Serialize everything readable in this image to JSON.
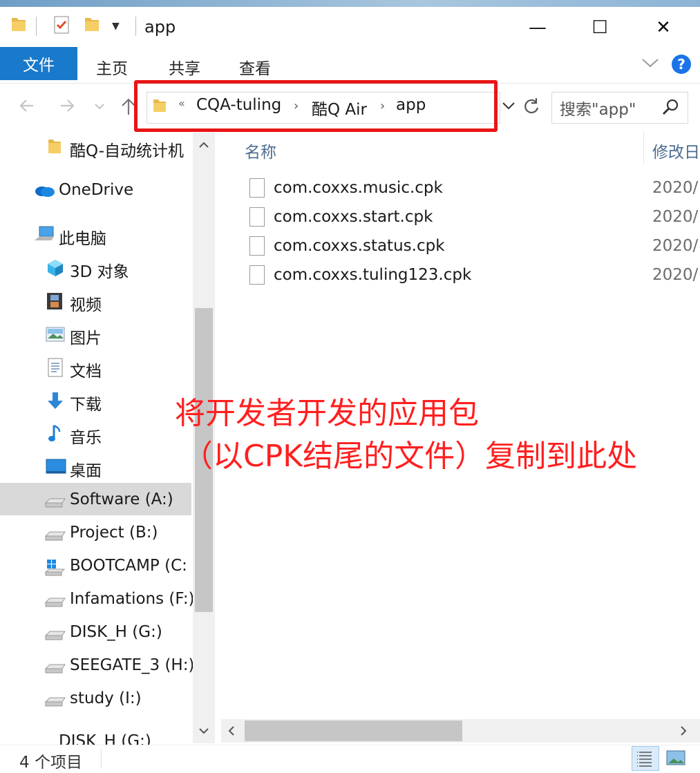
{
  "window": {
    "title": "app",
    "minimize": "—",
    "maximize": "☐",
    "close": "✕"
  },
  "ribbon": {
    "tabs": [
      "文件",
      "主页",
      "共享",
      "查看"
    ],
    "help": "?"
  },
  "address": {
    "overflow": "«",
    "crumbs": [
      "CQA-tuling",
      "酷Q Air",
      "app"
    ],
    "separator": "›"
  },
  "search": {
    "placeholder": "搜索\"app\""
  },
  "nav_pane": {
    "items": [
      {
        "label": "酷Q-自动统计机",
        "icon": "folder-icon"
      },
      {
        "label": "OneDrive",
        "icon": "cloud-icon"
      },
      {
        "label": "此电脑",
        "icon": "computer-icon"
      },
      {
        "label": "3D 对象",
        "icon": "cube-icon"
      },
      {
        "label": "视频",
        "icon": "film-icon"
      },
      {
        "label": "图片",
        "icon": "picture-icon"
      },
      {
        "label": "文档",
        "icon": "document-icon"
      },
      {
        "label": "下载",
        "icon": "download-arrow-icon"
      },
      {
        "label": "音乐",
        "icon": "music-note-icon"
      },
      {
        "label": "桌面",
        "icon": "desktop-icon"
      },
      {
        "label": "Software (A:)",
        "icon": "drive-icon"
      },
      {
        "label": "Project (B:)",
        "icon": "drive-icon"
      },
      {
        "label": "BOOTCAMP (C:",
        "icon": "windows-drive-icon"
      },
      {
        "label": "Infamations (F:)",
        "icon": "drive-icon"
      },
      {
        "label": "DISK_H (G:)",
        "icon": "drive-icon"
      },
      {
        "label": "SEEGATE_3 (H:)",
        "icon": "drive-icon"
      },
      {
        "label": "study (I:)",
        "icon": "drive-icon"
      },
      {
        "label": "DISK_H (G:)",
        "icon": "drive-icon"
      }
    ],
    "selected": "Software (A:)"
  },
  "columns": {
    "name": "名称",
    "modified": "修改日"
  },
  "files": [
    {
      "name": "com.coxxs.music.cpk",
      "date": "2020/"
    },
    {
      "name": "com.coxxs.start.cpk",
      "date": "2020/"
    },
    {
      "name": "com.coxxs.status.cpk",
      "date": "2020/"
    },
    {
      "name": "com.coxxs.tuling123.cpk",
      "date": "2020/"
    }
  ],
  "annotation": {
    "line1": "将开发者开发的应用包",
    "line2": "（以CPK结尾的文件）复制到此处",
    "color": "#ff1f1f"
  },
  "status": {
    "item_count": "4 个项目"
  },
  "colors": {
    "accent": "#1979ca",
    "highlight_box": "#e81515"
  }
}
